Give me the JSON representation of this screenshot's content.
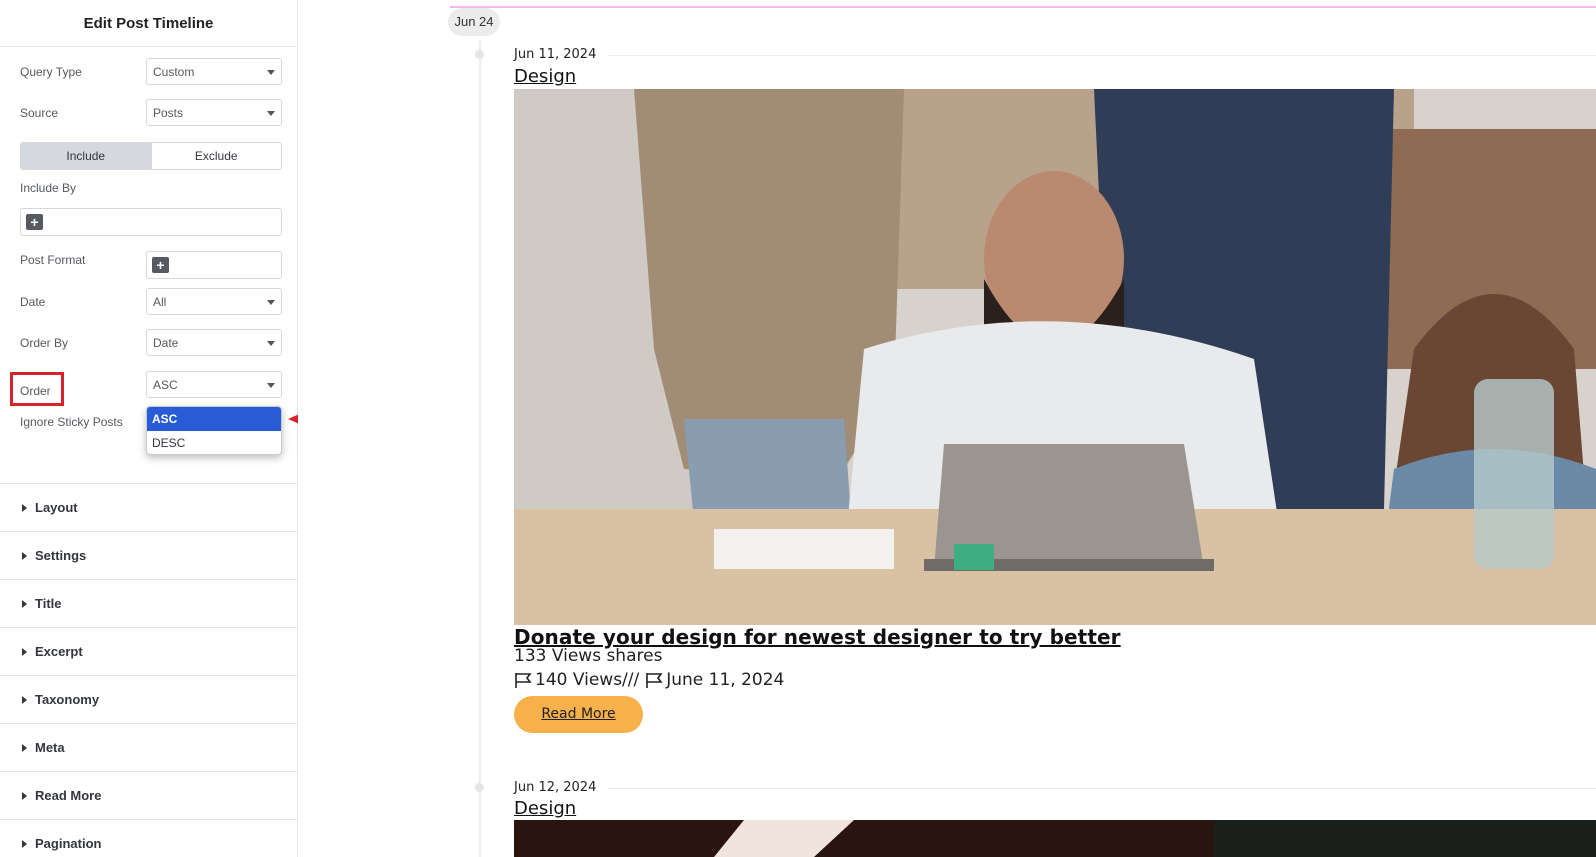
{
  "panel": {
    "title": "Edit Post Timeline",
    "controls": {
      "query_type": {
        "label": "Query Type",
        "value": "Custom"
      },
      "source": {
        "label": "Source",
        "value": "Posts"
      },
      "include_toggle": {
        "include": "Include",
        "exclude": "Exclude",
        "active": "Include"
      },
      "include_by": {
        "label": "Include By"
      },
      "post_format": {
        "label": "Post Format"
      },
      "date": {
        "label": "Date",
        "value": "All"
      },
      "order_by": {
        "label": "Order By",
        "value": "Date"
      },
      "order": {
        "label": "Order",
        "value": "ASC",
        "options": [
          "ASC",
          "DESC"
        ]
      },
      "ignore_sticky": {
        "label": "Ignore Sticky Posts"
      }
    },
    "sections": [
      "Layout",
      "Settings",
      "Title",
      "Excerpt",
      "Taxonomy",
      "Meta",
      "Read More",
      "Pagination"
    ],
    "colors": {
      "highlight": "#d8232a",
      "selected_option": "#2a5bd7"
    }
  },
  "preview": {
    "month_label": "Jun 24",
    "posts": [
      {
        "date": "Jun 11, 2024",
        "category": "Design",
        "title": "Donate your design for newest designer to try better",
        "shares_line": "133  Views shares",
        "views_line": "140 Views///",
        "date_line": "June 11, 2024",
        "read_more": "Read More"
      },
      {
        "date": "Jun 12, 2024",
        "category": "Design"
      }
    ],
    "colors": {
      "read_more_bg": "#f8b04a",
      "accent_line": "#f3b8f0"
    }
  }
}
